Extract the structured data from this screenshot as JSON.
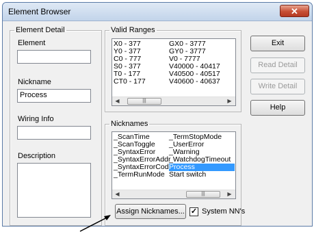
{
  "window": {
    "title": "Element Browser",
    "close_glyph": "✕"
  },
  "element_detail": {
    "legend": "Element Detail",
    "element_label": "Element",
    "element_value": "",
    "nickname_label": "Nickname",
    "nickname_value": "Process",
    "wiring_label": "Wiring Info",
    "wiring_value": "",
    "description_label": "Description",
    "description_value": ""
  },
  "valid_ranges": {
    "legend": "Valid Ranges",
    "col1": [
      "X0 - 377",
      "Y0 - 377",
      "C0 - 777",
      "S0 - 377",
      "T0 - 177",
      "CT0 - 177"
    ],
    "col2": [
      "GX0 - 3777",
      "GY0 - 3777",
      "V0 - 7777",
      "V40000 - 40417",
      "V40500 - 40517",
      "V40600 - 40637"
    ],
    "scroll_left": "◀",
    "scroll_thumb": "|||",
    "scroll_right": "▶"
  },
  "nicknames": {
    "legend": "Nicknames",
    "col1": [
      "_ScanTime",
      "_ScanToggle",
      "_SyntaxError",
      "_SyntaxErrorAddr",
      "_SyntaxErrorCode",
      "_TermRunMode"
    ],
    "col2": [
      "_TermStopMode",
      "_UserError",
      "_Warning",
      "_WatchdogTimeout",
      "Process",
      "Start switch"
    ],
    "selected": "Process",
    "scroll_left": "◀",
    "scroll_thumb": "|||",
    "scroll_right": "▶",
    "assign_button": "Assign Nicknames...",
    "system_nn_label": "System NN's",
    "system_nn_checked": "✓"
  },
  "buttons": {
    "exit": "Exit",
    "read_detail": "Read Detail",
    "write_detail": "Write Detail",
    "help": "Help"
  },
  "colors": {
    "selection": "#3399ff",
    "close_button": "#c74f35",
    "annotation_arrow": "#000000"
  },
  "icons": {
    "close": "close-icon",
    "check": "check-icon",
    "arrow": "annotation-arrow-icon"
  }
}
